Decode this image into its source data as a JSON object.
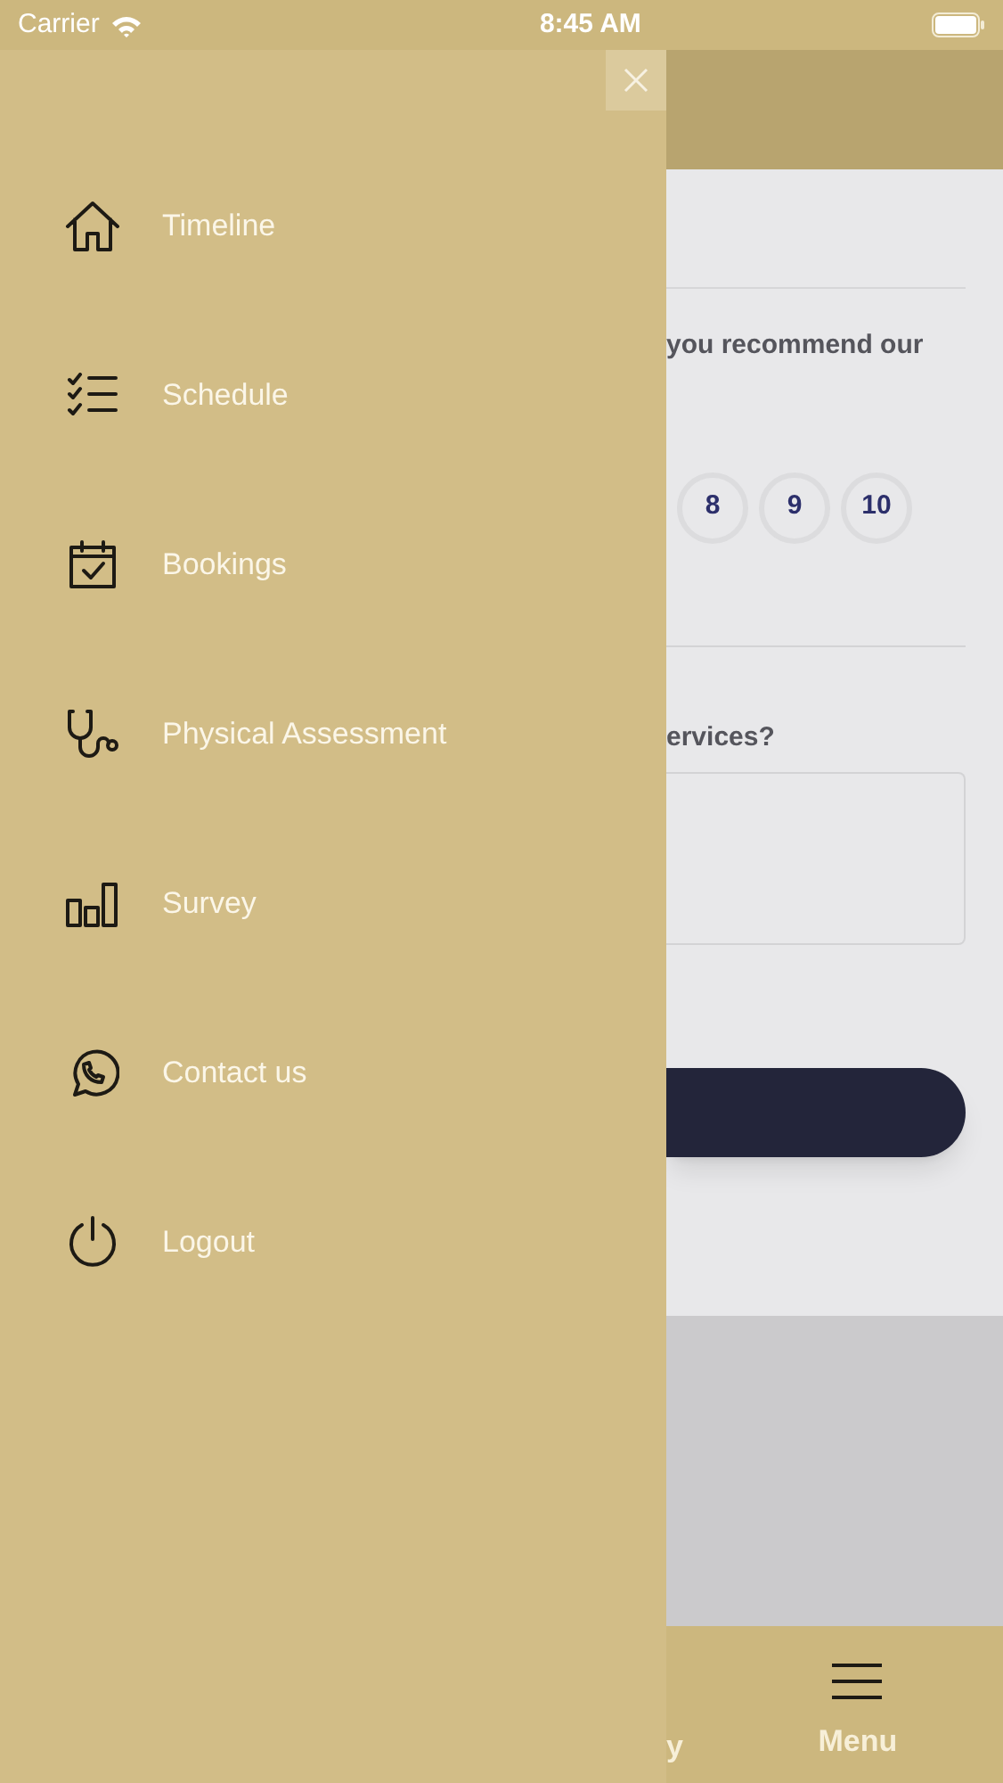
{
  "status_bar": {
    "carrier": "Carrier",
    "time": "8:45 AM"
  },
  "drawer": {
    "items": [
      {
        "kind": "home",
        "label": "Timeline"
      },
      {
        "kind": "checklist",
        "label": "Schedule"
      },
      {
        "kind": "calendar",
        "label": "Bookings"
      },
      {
        "kind": "stethoscope",
        "label": "Physical Assessment"
      },
      {
        "kind": "chart",
        "label": "Survey"
      },
      {
        "kind": "chat",
        "label": "Contact us"
      },
      {
        "kind": "power",
        "label": "Logout"
      }
    ]
  },
  "page": {
    "question_1": "you  recommend  our",
    "scores": [
      "8",
      "9",
      "10"
    ],
    "question_2": "ervices?"
  },
  "tab_bar": {
    "items": [
      {
        "kind": "text",
        "label": "y"
      },
      {
        "kind": "menu",
        "label": "Menu"
      }
    ]
  }
}
